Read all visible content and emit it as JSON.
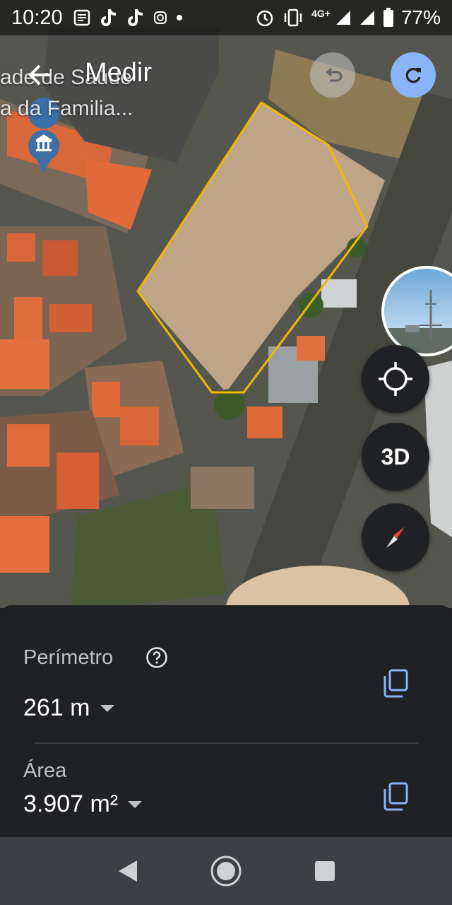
{
  "status_bar": {
    "time": "10:20",
    "left_icons": [
      "news-icon",
      "tiktok-icon",
      "tiktok-icon",
      "instagram-icon",
      "dot-icon"
    ],
    "right_icons": [
      "alarm-icon",
      "vibrate-icon",
      "signal-icon",
      "signal-icon",
      "battery-icon"
    ],
    "network": "4G+",
    "battery": "77%"
  },
  "top_bar": {
    "place_lines": [
      "ade de Saúde",
      "a da Familia..."
    ],
    "title": "Medir",
    "back_icon": "arrow-back-icon",
    "undo_icon": "undo-icon",
    "redo_icon": "redo-icon"
  },
  "map": {
    "pin_icon": "museum-pin-icon",
    "measure_color": "#f2b705"
  },
  "controls": {
    "locate_icon": "my-location-icon",
    "view_3d": "3D",
    "compass_icon": "compass-icon"
  },
  "measurements": {
    "perimeter_label": "Perímetro",
    "perimeter_value": "261 m",
    "area_label": "Área",
    "area_value": "3.907 m²",
    "help_icon": "help-icon",
    "copy_icon": "copy-icon",
    "dropdown_icon": "caret-down-icon"
  },
  "nav_bar": {
    "icons": [
      "back-triangle-icon",
      "home-circle-icon",
      "recents-square-icon"
    ]
  },
  "colors": {
    "accent_blue": "#8ab4f8",
    "sheet_bg": "#202124",
    "nav_bg": "#3c3f43"
  }
}
